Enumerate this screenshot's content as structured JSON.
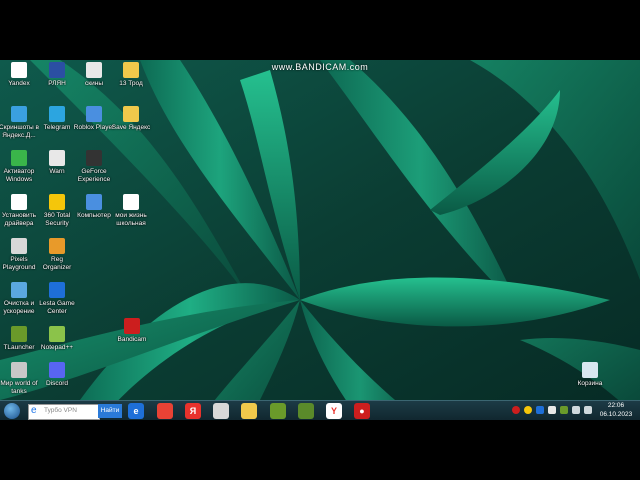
{
  "watermark": "www.BANDICAM.com",
  "desktop": {
    "icons": [
      {
        "label": "Yandex",
        "icon": "yandex-icon",
        "color": "#ffffff"
      },
      {
        "label": "РЛЯН",
        "icon": "app-icon",
        "color": "#2b4fa3"
      },
      {
        "label": "скины",
        "icon": "file-icon",
        "color": "#e8e8e8"
      },
      {
        "label": "13 Трод",
        "icon": "folder-icon",
        "color": "#f0c94b"
      },
      {
        "label": "Скриншоты в Яндекс.Д...",
        "icon": "screenshot-icon",
        "color": "#3aa0e0"
      },
      {
        "label": "Telegram",
        "icon": "telegram-icon",
        "color": "#2ca5e0"
      },
      {
        "label": "Roblox Player",
        "icon": "roblox-icon",
        "color": "#4a8fe0"
      },
      {
        "label": "Save Яндекс",
        "icon": "folder-icon",
        "color": "#f0c94b"
      },
      {
        "label": "Активатор Windows",
        "icon": "activator-icon",
        "color": "#3ab54a"
      },
      {
        "label": "Warn",
        "icon": "warn-icon",
        "color": "#e8e8e8"
      },
      {
        "label": "GeForce Experience",
        "icon": "geforce-icon",
        "color": "#333333"
      },
      {
        "label": "Установить драйвера",
        "icon": "driver-icon",
        "color": "#ffffff"
      },
      {
        "label": "360 Total Security",
        "icon": "security-icon",
        "color": "#f5c60a"
      },
      {
        "label": "Компьютер",
        "icon": "computer-icon",
        "color": "#4a8fe0"
      },
      {
        "label": "мои жизнь школьная",
        "icon": "document-icon",
        "color": "#ffffff"
      },
      {
        "label": "Pixels Playground",
        "icon": "game-icon",
        "color": "#d8d8d8"
      },
      {
        "label": "Reg Organizer",
        "icon": "reg-organizer-icon",
        "color": "#e89a2a"
      },
      {
        "label": "Очистка и ускорение",
        "icon": "cleanup-icon",
        "color": "#5aa8e0"
      },
      {
        "label": "Lesta Game Center",
        "icon": "lesta-icon",
        "color": "#1e6fd8"
      },
      {
        "label": "Bandicam",
        "icon": "bandicam-icon",
        "color": "#cc1e1e"
      },
      {
        "label": "TLauncher",
        "icon": "tlauncher-icon",
        "color": "#6a9a2a"
      },
      {
        "label": "Notepad++",
        "icon": "notepad-icon",
        "color": "#8bc34a"
      },
      {
        "label": "Мир world of tanks",
        "icon": "tanks-icon",
        "color": "#c8c8c8"
      },
      {
        "label": "Discord",
        "icon": "discord-icon",
        "color": "#5865f2"
      },
      {
        "label": "Корзина",
        "icon": "recycle-bin-icon",
        "color": "#d8e8f0"
      }
    ]
  },
  "taskbar": {
    "search_placeholder": "Турбо VPN",
    "search_button": "Найти",
    "pinned": [
      {
        "name": "internet-explorer-icon",
        "color": "#1e6fd8",
        "glyph": "e"
      },
      {
        "name": "chrome-icon",
        "color": "#e94235",
        "glyph": ""
      },
      {
        "name": "yandex-browser-icon",
        "color": "#e8322c",
        "glyph": "Я"
      },
      {
        "name": "roblox-icon",
        "color": "#d8d8d8",
        "glyph": ""
      },
      {
        "name": "explorer-icon",
        "color": "#f0c94b",
        "glyph": ""
      },
      {
        "name": "minecraft-icon",
        "color": "#6a9a2a",
        "glyph": ""
      },
      {
        "name": "minecraft-launcher-icon",
        "color": "#5a8a2a",
        "glyph": ""
      },
      {
        "name": "yandex-icon",
        "color": "#ffffff",
        "glyph": "Y"
      },
      {
        "name": "bandicam-icon",
        "color": "#cc1e1e",
        "glyph": "●"
      }
    ],
    "clock_time": "22:06",
    "clock_date": "06.10.2023"
  }
}
